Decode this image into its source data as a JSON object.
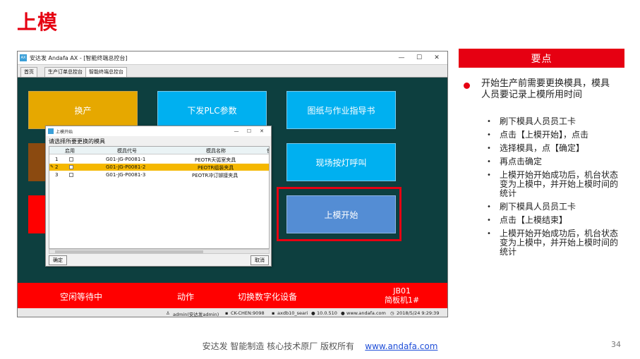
{
  "slide": {
    "title": "上模",
    "page_number": "34",
    "footer_text": "安达发   智能制造 核心技术原厂    版权所有",
    "footer_link": "www.andafa.com"
  },
  "app": {
    "window_title": "安达发 Andafa AX - [智能终端总控台]",
    "icon_label": "AX",
    "controls": [
      "—",
      "☐",
      "✕"
    ],
    "tabs": [
      {
        "label": "首页",
        "active": false
      },
      {
        "label": "生产订单总控台",
        "active": false
      },
      {
        "label": "智能终端总控台",
        "active": true
      }
    ],
    "tiles": {
      "change_product": "换产",
      "plc_params": "下发PLC参数",
      "drawings": "图纸与作业指导书",
      "andon_call": "现场按灯呼叫",
      "mold_start": "上模开始"
    },
    "bottom_bar": {
      "status": "空闲等待中",
      "action": "动作",
      "switch_device": "切换数字化设备",
      "machine_code": "JB01",
      "machine_name": "简板机1#"
    },
    "status_bar": {
      "user": "admin(安达发admin)",
      "host": "CK-CHEN:9098",
      "database": "axdb10_seari",
      "ip": "10.0.510",
      "website": "www.andafa.com",
      "datetime": "2018/5/24 9:29:39"
    }
  },
  "dialog": {
    "title": "上模开始",
    "prompt": "请选择所要更换的模具",
    "columns": [
      "启用",
      "模具代号",
      "模具名称",
      "使"
    ],
    "rows": [
      {
        "no": "1",
        "code": "G01-JG-P0081-1",
        "name": "PEOTR天弧室夹具",
        "selected": false
      },
      {
        "no": "2",
        "code": "G01-JG-P0081-2",
        "name": "PEOTR组装夹具",
        "selected": true
      },
      {
        "no": "3",
        "code": "G01-JG-P0081-3",
        "name": "PEOTR冲订铆接夹具",
        "selected": false
      }
    ],
    "ok_label": "确定",
    "cancel_label": "取消",
    "selected_color": "#f5b800"
  },
  "panel": {
    "header": "要点",
    "main_point": "开始生产前需要更换模具，模具人员要记录上模所用时间",
    "sub_points": [
      "刷下模具人员员工卡",
      "点击【上模开始】，点击",
      "选择模具，点【确定】",
      "再点击确定",
      "上模开始开始成功后，机台状态变为上模中，并开始上模时间的统计",
      "刷下模具人员员工卡",
      "点击【上模结束】",
      "上模开始开始成功后，机台状态变为上模中，并开始上模时间的统计"
    ]
  },
  "colors": {
    "brand_red": "#e60012",
    "app_background": "#0d3f3f",
    "tile_yellow": "#e6a800",
    "tile_blue": "#00b0f0",
    "tile_steel": "#548dd4"
  }
}
